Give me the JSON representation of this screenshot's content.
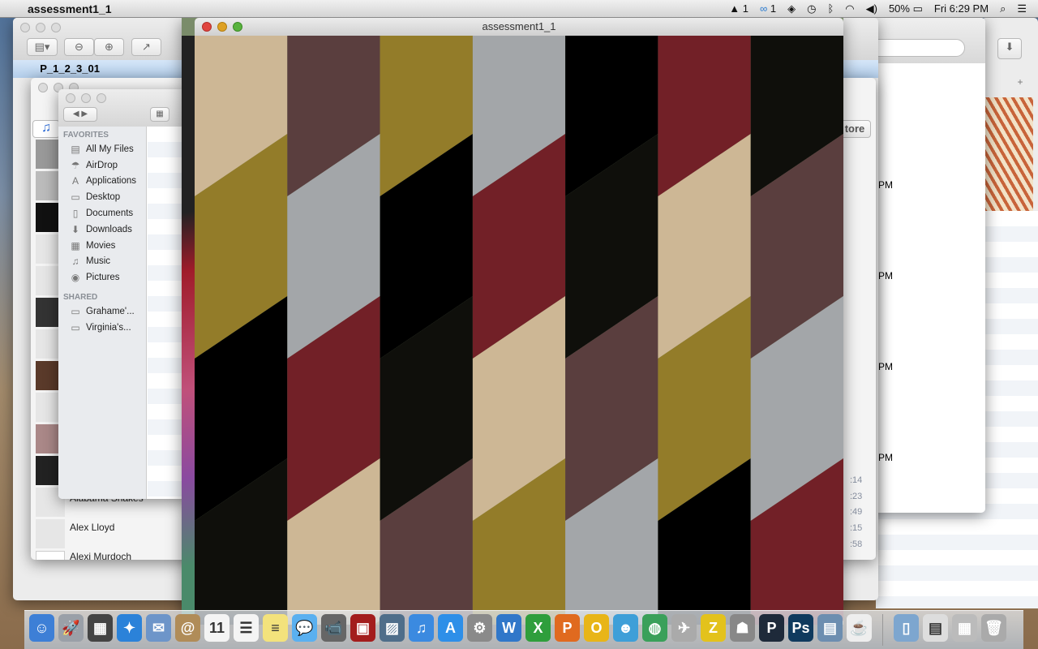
{
  "menubar": {
    "app_name": "assessment1_1",
    "adobe_count": "1",
    "cc_count": "1",
    "battery": "50%",
    "clock": "Fri 6:29 PM"
  },
  "preview_window": {
    "doc_title": "P_1_2_3_01"
  },
  "finder": {
    "favorites_label": "FAVORITES",
    "shared_label": "SHARED",
    "favorites": [
      {
        "label": "All My Files",
        "icon": "▤"
      },
      {
        "label": "AirDrop",
        "icon": "☂"
      },
      {
        "label": "Applications",
        "icon": "A"
      },
      {
        "label": "Desktop",
        "icon": "▭"
      },
      {
        "label": "Documents",
        "icon": "▯"
      },
      {
        "label": "Downloads",
        "icon": "⬇"
      },
      {
        "label": "Movies",
        "icon": "▦"
      },
      {
        "label": "Music",
        "icon": "♫"
      },
      {
        "label": "Pictures",
        "icon": "◉"
      }
    ],
    "shared": [
      {
        "label": "Grahame'...",
        "icon": "▭"
      },
      {
        "label": "Virginia's...",
        "icon": "▭"
      }
    ]
  },
  "itunes": {
    "artists": [
      "Alabama Shakes",
      "Alex Lloyd",
      "Alexi Murdoch"
    ],
    "store_button": "tore",
    "times": [
      ":14",
      ":23",
      ":49",
      ":15",
      ":58"
    ],
    "pm_labels": [
      "PM",
      "PM",
      "PM",
      "PM"
    ]
  },
  "sketch_window": {
    "title": "assessment1_1"
  },
  "pattern": {
    "palette": [
      "#cdb795",
      "#937c29",
      "#000000",
      "#0f0f0b",
      "#5a3e3e",
      "#a3a6a9",
      "#722027"
    ],
    "column_start_index": [
      0,
      4,
      1,
      5,
      2,
      6,
      3
    ]
  },
  "dock": [
    {
      "name": "finder",
      "bg": "#3d7fd6",
      "label": "☺"
    },
    {
      "name": "launchpad",
      "bg": "#9aa0a8",
      "label": "🚀"
    },
    {
      "name": "mission-control",
      "bg": "#444",
      "label": "▦"
    },
    {
      "name": "safari",
      "bg": "#2b82d9",
      "label": "✦"
    },
    {
      "name": "mail",
      "bg": "#6d95c9",
      "label": "✉"
    },
    {
      "name": "contacts",
      "bg": "#b08c58",
      "label": "@"
    },
    {
      "name": "calendar",
      "bg": "#f4f4f4",
      "label": "11"
    },
    {
      "name": "reminders",
      "bg": "#f4f4f4",
      "label": "☰"
    },
    {
      "name": "notes",
      "bg": "#f3e27c",
      "label": "≡"
    },
    {
      "name": "messages",
      "bg": "#5ab0f0",
      "label": "💬"
    },
    {
      "name": "facetime",
      "bg": "#666",
      "label": "📹"
    },
    {
      "name": "photo-booth",
      "bg": "#a31d1d",
      "label": "▣"
    },
    {
      "name": "iphoto",
      "bg": "#4f6e8a",
      "label": "▨"
    },
    {
      "name": "itunes",
      "bg": "#3b8ae0",
      "label": "♫"
    },
    {
      "name": "app-store",
      "bg": "#2e8fe8",
      "label": "A"
    },
    {
      "name": "system-preferences",
      "bg": "#8a8a8a",
      "label": "⚙"
    },
    {
      "name": "word",
      "bg": "#3077c9",
      "label": "W"
    },
    {
      "name": "excel",
      "bg": "#2f9e3c",
      "label": "X"
    },
    {
      "name": "powerpoint",
      "bg": "#e06a1f",
      "label": "P"
    },
    {
      "name": "outlook",
      "bg": "#e8b518",
      "label": "O"
    },
    {
      "name": "messenger",
      "bg": "#3e9fd8",
      "label": "☻"
    },
    {
      "name": "network-utility",
      "bg": "#3aa05a",
      "label": "◍"
    },
    {
      "name": "directory-utility",
      "bg": "#aaa",
      "label": "✈"
    },
    {
      "name": "filezilla",
      "bg": "#e3c21c",
      "label": "Z"
    },
    {
      "name": "automator",
      "bg": "#888",
      "label": "☗"
    },
    {
      "name": "processing",
      "bg": "#1e2a3a",
      "label": "P"
    },
    {
      "name": "photoshop",
      "bg": "#0f3a5e",
      "label": "Ps"
    },
    {
      "name": "preview",
      "bg": "#6d8eb0",
      "label": "▤"
    },
    {
      "name": "java",
      "bg": "#eee",
      "label": "☕"
    },
    {
      "name": "applications-folder",
      "bg": "#7da6cf",
      "label": "▯"
    },
    {
      "name": "document-stack",
      "bg": "#ddd",
      "label": "▤"
    },
    {
      "name": "downloads-stack",
      "bg": "#bbb",
      "label": "▦"
    },
    {
      "name": "trash",
      "bg": "#aaa",
      "label": "🗑"
    }
  ]
}
